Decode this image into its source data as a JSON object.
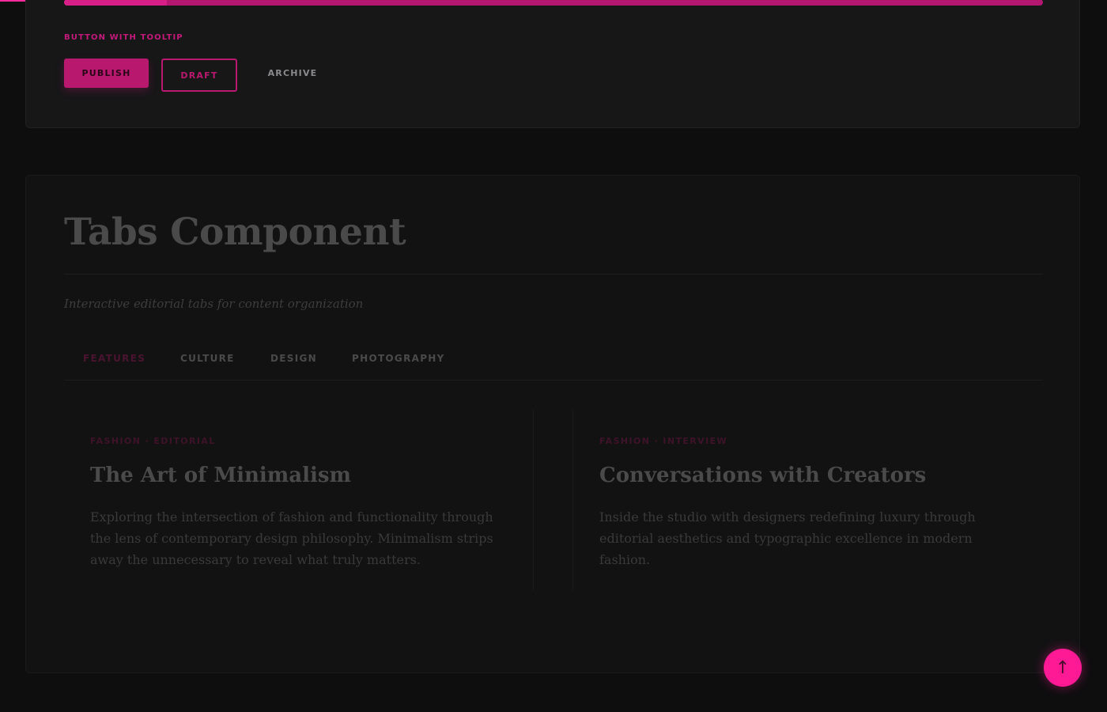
{
  "page_progress": 0.15,
  "top_card": {
    "slider_level": 0.105,
    "section_label": "BUTTON WITH TOOLTIP",
    "buttons": {
      "publish": "PUBLISH",
      "draft": "DRAFT",
      "archive": "ARCHIVE"
    }
  },
  "tabs_section": {
    "title": "Tabs Component",
    "subtitle": "Interactive editorial tabs for content organization",
    "tabs": [
      {
        "label": "FEATURES",
        "active": true
      },
      {
        "label": "CULTURE",
        "active": false
      },
      {
        "label": "DESIGN",
        "active": false
      },
      {
        "label": "PHOTOGRAPHY",
        "active": false
      }
    ],
    "articles": [
      {
        "kicker": "FASHION · EDITORIAL",
        "title": "The Art of Minimalism",
        "body": "Exploring the intersection of fashion and functionality through the lens of contemporary design philosophy. Minimalism strips away the unnecessary to reveal what truly matters."
      },
      {
        "kicker": "FASHION · INTERVIEW",
        "title": "Conversations with Creators",
        "body": "Inside the studio with designers redefining luxury through editorial aesthetics and typographic excellence in modern fashion."
      }
    ]
  },
  "back_to_top": {
    "icon": "arrow-up-icon",
    "glyph": "↑"
  },
  "colors": {
    "accent": "#ff1a95",
    "accent_dark": "#b8196f",
    "background": "#0e0e0f"
  }
}
